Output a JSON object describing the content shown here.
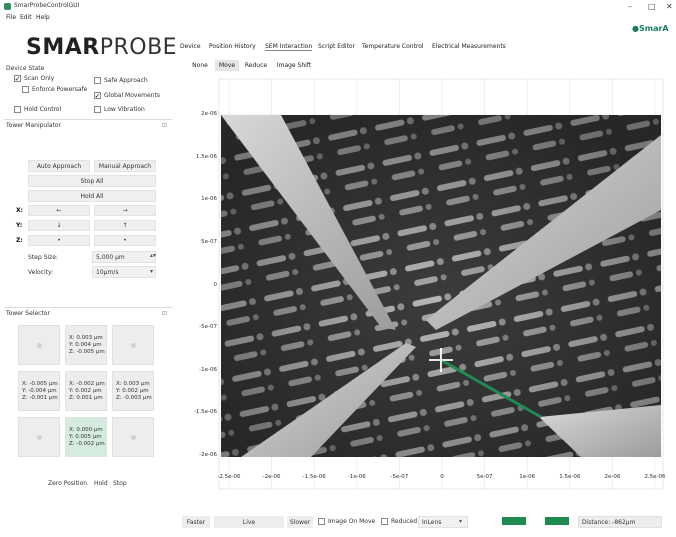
{
  "window": {
    "title": "SmarProbeControlGUI",
    "min": "–",
    "max": "□",
    "close": "✕"
  },
  "menu": [
    "File",
    "Edit",
    "Help"
  ],
  "corner_logo": "SmarA",
  "logo": {
    "bold": "SMAR",
    "light": "PROBE"
  },
  "device_state": {
    "title": "Device State",
    "options": [
      {
        "label": "Scan Only",
        "checked": true
      },
      {
        "label": "Safe Approach",
        "checked": false
      },
      {
        "label": "Enforce Powersafe",
        "checked": false
      },
      {
        "label": "Global Movements",
        "checked": true
      },
      {
        "label": "Hold Control",
        "checked": false
      },
      {
        "label": "Low Vibration",
        "checked": false
      }
    ]
  },
  "tower_manipulator": {
    "title": "Tower Manipulator",
    "pin": "⊡",
    "auto_approach": "Auto Approach",
    "manual_approach": "Manual Approach",
    "stop_all": "Stop All",
    "hold_all": "Hold All",
    "axes": [
      {
        "label": "X:",
        "minus": "←",
        "plus": "→"
      },
      {
        "label": "Y:",
        "minus": "↓",
        "plus": "↑"
      },
      {
        "label": "Z:",
        "minus": "•",
        "plus": "•"
      }
    ],
    "step_size_label": "Step Size:",
    "step_size_value": "5,000 µm",
    "velocity_label": "Velocity:",
    "velocity_value": "10µm/s",
    "spin_up": "▴▾",
    "select_arrow": "▾"
  },
  "tower_selector": {
    "title": "Tower Selector",
    "pin": "⊡",
    "cells": [
      [
        {
          "lines": []
        },
        {
          "lines": [
            "X: 0.003 µm",
            "Y: 0.004 µm",
            "Z: -0.005 µm"
          ]
        },
        {
          "lines": []
        }
      ],
      [
        {
          "lines": [
            "X: -0.005 µm",
            "Y: -0.004 µm",
            "Z: -0.001 µm"
          ]
        },
        {
          "lines": [
            "X: -0.002 µm",
            "Y: 0.002 µm",
            "Z: 0.001 µm"
          ]
        },
        {
          "lines": [
            "X: 0.003 µm",
            "Y: 0.002 µm",
            "Z: -0.003 µm"
          ]
        }
      ],
      [
        {
          "lines": []
        },
        {
          "lines": [
            "X: 0.000 µm",
            "Y: 0.005 µm",
            "Z: -0.002 µm"
          ],
          "selected": true
        },
        {
          "lines": []
        }
      ]
    ],
    "zero_position": "Zero Position",
    "hold": "Hold",
    "stop": "Stop"
  },
  "tabs": [
    "Device",
    "Position History",
    "SEM Interaction",
    "Script Editor",
    "Temperature Control",
    "Electrical Measurements"
  ],
  "active_tab": "SEM Interaction",
  "subtabs": [
    "None",
    "Move",
    "Reduce",
    "Image Shift"
  ],
  "active_subtab": "Move",
  "plot": {
    "y_ticks": [
      "2e-06",
      "1.5e-06",
      "1e-06",
      "5e-07",
      "0",
      "-5e-07",
      "-1e-06",
      "-1.5e-06",
      "-2e-06"
    ],
    "x_ticks": [
      "-2.5e-06",
      "-2e-06",
      "-1.5e-06",
      "-1e-06",
      "-5e-07",
      "0",
      "5e-07",
      "1e-06",
      "1.5e-06",
      "2e-06",
      "2.5e-06"
    ]
  },
  "bottom_bar": {
    "faster": "Faster",
    "live": "Live",
    "slower": "Slower",
    "image_on_move": "Image On Move",
    "reduced": "Reduced",
    "lens_value": "InLens",
    "lens_arrow": "▾",
    "distance": "Distance: -862µm"
  },
  "colors": {
    "accent": "#1f8a52",
    "line": "#1f8a52"
  }
}
